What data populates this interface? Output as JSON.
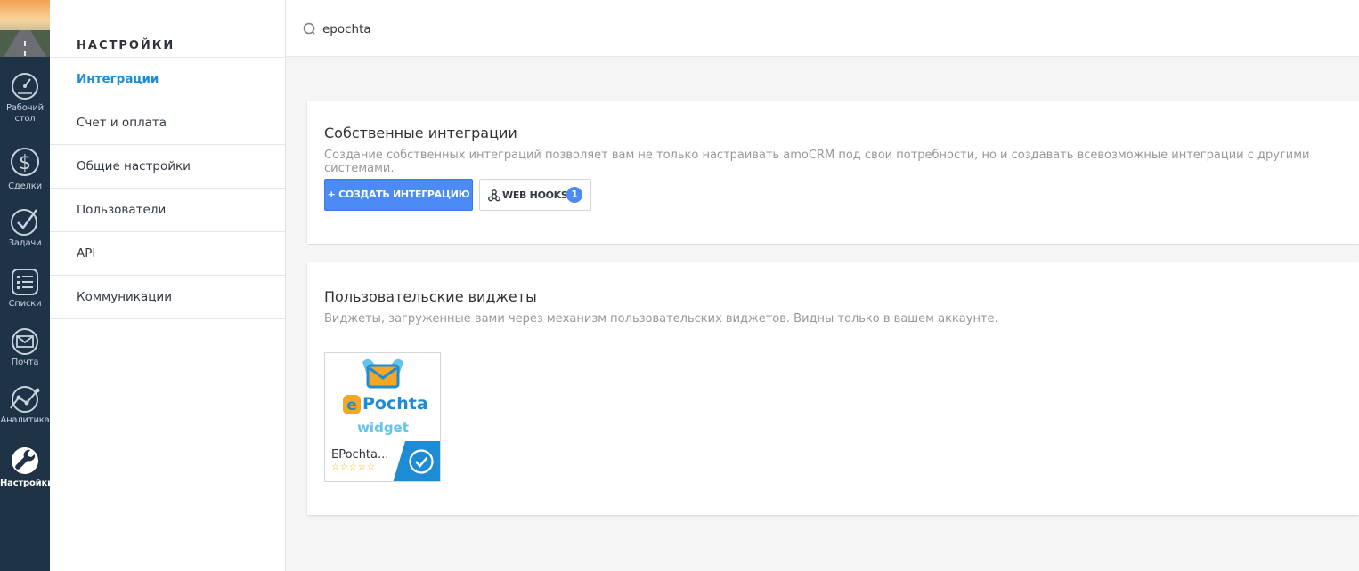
{
  "rail": {
    "items": [
      {
        "label": "Рабочий стол",
        "icon": "dashboard-icon"
      },
      {
        "label": "Сделки",
        "icon": "dollar-icon"
      },
      {
        "label": "Задачи",
        "icon": "checkmark-icon"
      },
      {
        "label": "Списки",
        "icon": "list-icon"
      },
      {
        "label": "Почта",
        "icon": "mail-icon"
      },
      {
        "label": "Аналитика",
        "icon": "analytics-icon"
      },
      {
        "label": "Настройки",
        "icon": "wrench-icon"
      }
    ]
  },
  "settings_menu": {
    "title": "НАСТРОЙКИ",
    "items": [
      "Интеграции",
      "Счет и оплата",
      "Общие настройки",
      "Пользователи",
      "API",
      "Коммуникации"
    ],
    "active_index": 0
  },
  "search": {
    "value": "epochta"
  },
  "own_integrations": {
    "title": "Собственные интеграции",
    "description": "Создание собственных интеграций позволяет вам не только настраивать amoCRM под свои потребности, но и создавать всевозможные интеграции с другими системами.",
    "create_button": "+ СОЗДАТЬ ИНТЕГРАЦИЮ",
    "webhooks_button": "WEB HOOKS",
    "webhooks_count": "1"
  },
  "user_widgets": {
    "title": "Пользовательские виджеты",
    "description": "Виджеты, загруженные вами через механизм пользовательских виджетов. Видны только в вашем аккаунте.",
    "widget": {
      "name": "EPochta...",
      "stars": "☆☆☆☆☆",
      "logo_word_e": "e",
      "logo_word_rest": "Pochta",
      "logo_sub": "widget",
      "status": "installed"
    }
  },
  "colors": {
    "rail_bg": "#1f3346",
    "accent": "#1e8bd5",
    "primary_button": "#4c8bf5",
    "installed_corner": "#1e8bd5",
    "logo_orange": "#f5a623",
    "logo_blue": "#1e8bd5",
    "logo_light_blue": "#63c3ea"
  }
}
